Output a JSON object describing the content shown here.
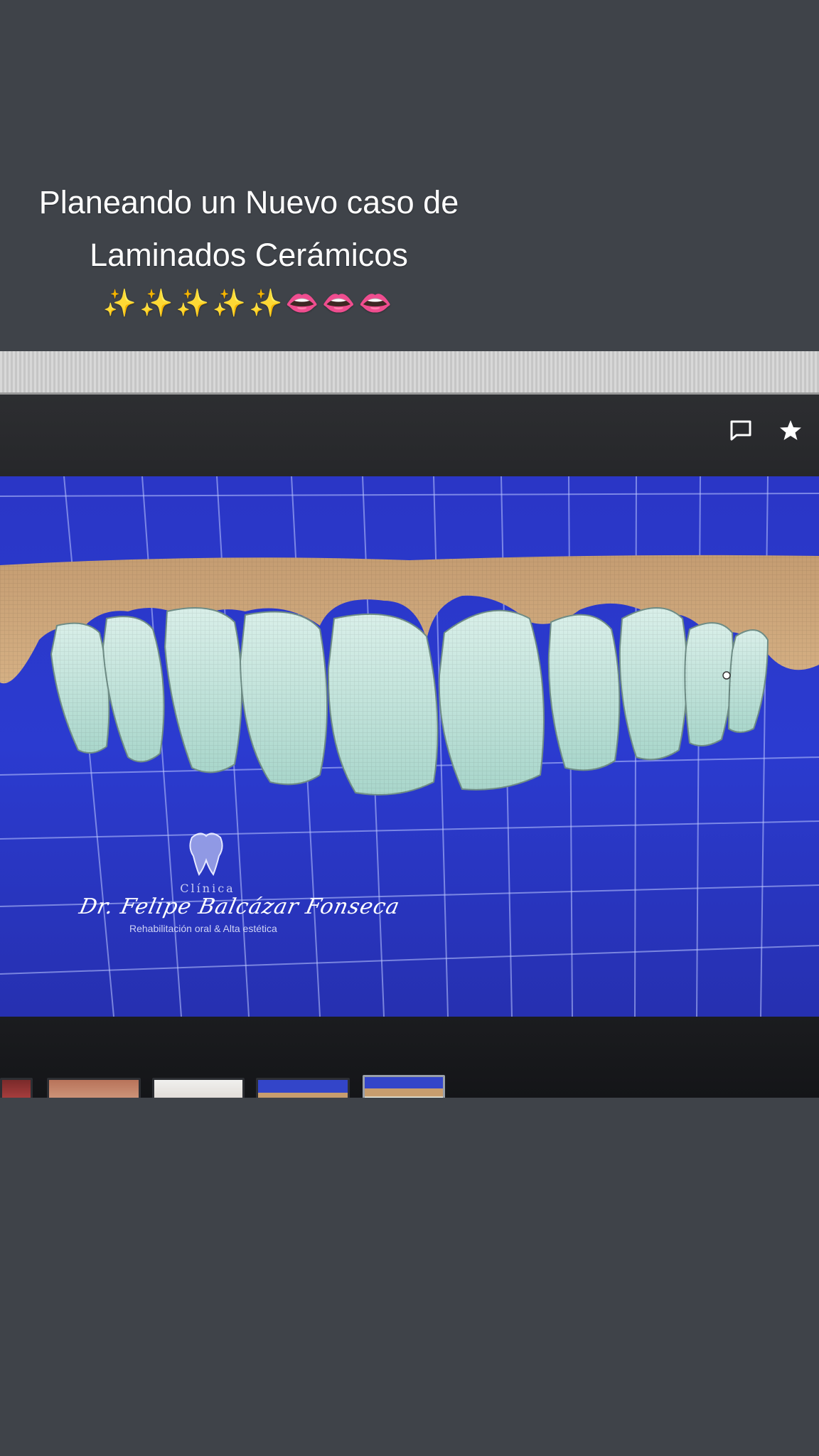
{
  "caption": {
    "line1": "Planeando un Nuevo caso de",
    "line2": "Laminados Cerámicos",
    "sparkles": "✨✨✨✨✨",
    "lips": "👄👄👄"
  },
  "toolbar": {
    "icons": [
      "comment-icon",
      "star-icon"
    ]
  },
  "watermark": {
    "clinic": "Clínica",
    "doctor": "Dr. Felipe Balcázar Fonseca",
    "specialty": "Rehabilitación oral & Alta estética"
  },
  "colors": {
    "background": "#3f4349",
    "viewport_blue": "#2b3bd0",
    "gum": "#c9a27a",
    "tooth": "#bfe3dc"
  },
  "thumbnails": {
    "count": 6,
    "selected_index": 5
  }
}
